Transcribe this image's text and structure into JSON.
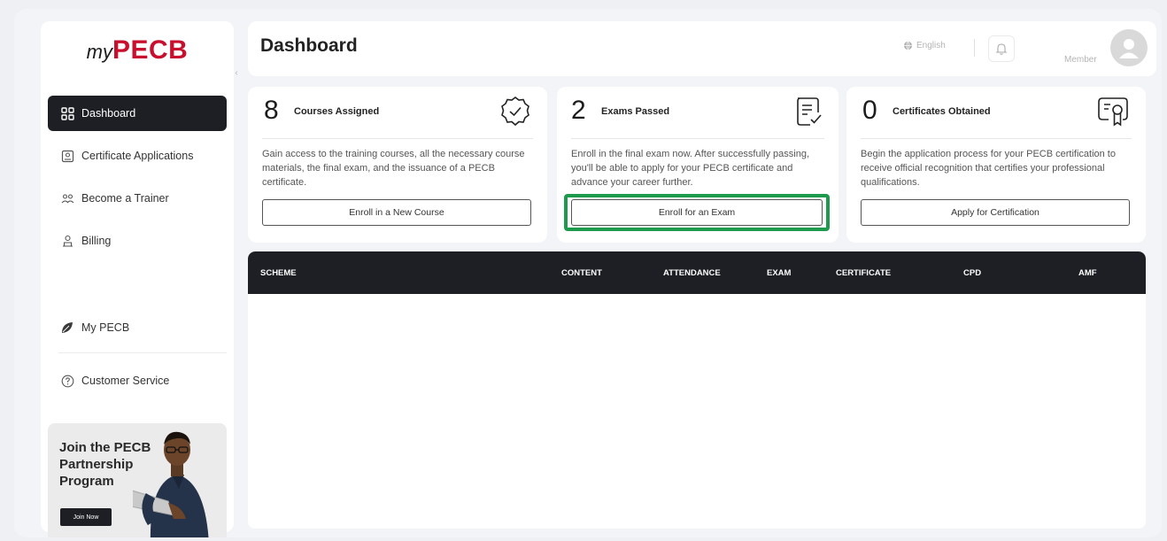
{
  "app": {
    "logo_my": "my",
    "logo_brand": "PECB"
  },
  "sidebar": {
    "items": [
      {
        "label": "Dashboard",
        "icon": "dashboard-grid-icon",
        "active": true
      },
      {
        "label": "Certificate Applications",
        "icon": "certificate-icon"
      },
      {
        "label": "Become a Trainer",
        "icon": "trainer-icon"
      },
      {
        "label": "Billing",
        "icon": "billing-icon"
      },
      {
        "label": "My PECB",
        "icon": "pecb-leaf-icon"
      },
      {
        "label": "Customer Service",
        "icon": "help-circle-icon"
      }
    ],
    "promo": {
      "text": "Join the PECB Partnership Program",
      "button": "Join Now"
    }
  },
  "header": {
    "title": "Dashboard",
    "language": "English",
    "member_label": "Member"
  },
  "cards": [
    {
      "count": "8",
      "label": "Courses Assigned",
      "icon": "check-badge-icon",
      "description": "Gain access to the training courses, all the necessary course materials, the final exam, and the issuance of a PECB certificate.",
      "button": "Enroll in a New Course"
    },
    {
      "count": "2",
      "label": "Exams Passed",
      "icon": "exam-checklist-icon",
      "description": "Enroll in the final exam now. After successfully passing, you'll be able to apply for your PECB certificate and advance your career further.",
      "button": "Enroll for an Exam",
      "highlighted": true
    },
    {
      "count": "0",
      "label": "Certificates Obtained",
      "icon": "certificate-ribbon-icon",
      "description": "Begin the application process for your PECB certification to receive official recognition that certifies your professional qualifications.",
      "button": "Apply for Certification"
    }
  ],
  "table": {
    "columns": [
      "SCHEME",
      "CONTENT",
      "ATTENDANCE",
      "EXAM",
      "CERTIFICATE",
      "CPD",
      "AMF"
    ]
  },
  "colors": {
    "brand_red": "#c8102e",
    "dark": "#1e1f24",
    "highlight_green": "#1e9a4c"
  }
}
